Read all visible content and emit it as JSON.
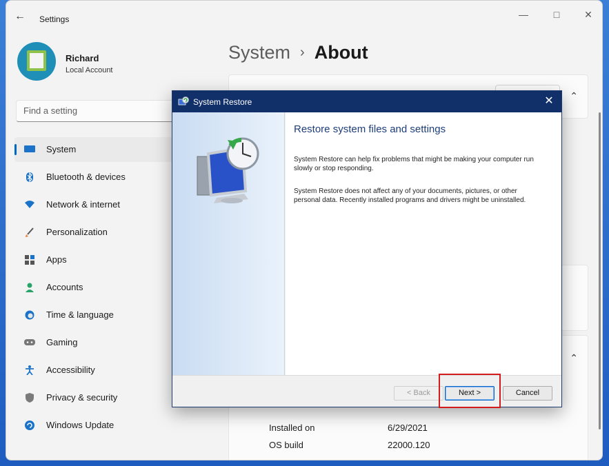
{
  "app": {
    "title": "Settings"
  },
  "profile": {
    "name": "Richard",
    "account_type": "Local Account"
  },
  "search": {
    "placeholder": "Find a setting"
  },
  "sidebar": {
    "items": [
      {
        "label": "System",
        "icon": "system-icon",
        "active": true
      },
      {
        "label": "Bluetooth & devices",
        "icon": "bluetooth-icon"
      },
      {
        "label": "Network & internet",
        "icon": "wifi-icon"
      },
      {
        "label": "Personalization",
        "icon": "brush-icon"
      },
      {
        "label": "Apps",
        "icon": "apps-icon"
      },
      {
        "label": "Accounts",
        "icon": "person-icon"
      },
      {
        "label": "Time & language",
        "icon": "globe-clock-icon"
      },
      {
        "label": "Gaming",
        "icon": "gamepad-icon"
      },
      {
        "label": "Accessibility",
        "icon": "accessibility-icon"
      },
      {
        "label": "Privacy & security",
        "icon": "shield-icon"
      },
      {
        "label": "Windows Update",
        "icon": "update-icon"
      }
    ]
  },
  "breadcrumb": {
    "parent": "System",
    "separator": "›",
    "current": "About"
  },
  "specs": [
    {
      "label": "Installed on",
      "value": "6/29/2021"
    },
    {
      "label": "OS build",
      "value": "22000.120"
    }
  ],
  "dialog": {
    "title": "System Restore",
    "heading": "Restore system files and settings",
    "paragraph1": "System Restore can help fix problems that might be making your computer run slowly or stop responding.",
    "paragraph2": "System Restore does not affect any of your documents, pictures, or other personal data. Recently installed programs and drivers might be uninstalled.",
    "back_label": "< Back",
    "next_label": "Next >",
    "cancel_label": "Cancel"
  },
  "colors": {
    "accent": "#0067c0",
    "dialog_titlebar": "#11306a",
    "highlight": "#d41b1b"
  }
}
